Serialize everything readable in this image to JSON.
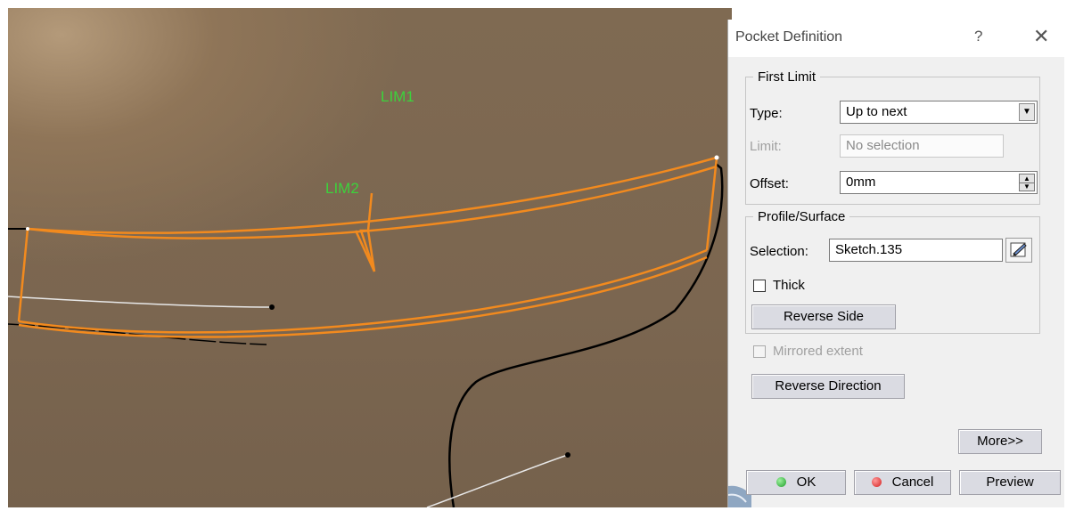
{
  "viewport": {
    "label_lim1": "LIM1",
    "label_lim2": "LIM2",
    "profile_color": "#f28a1e",
    "background_color": "#7d6850"
  },
  "dialog": {
    "title": "Pocket Definition",
    "help_label": "?",
    "close_label": "✕",
    "first_limit": {
      "legend": "First Limit",
      "type_label": "Type:",
      "type_value": "Up to next",
      "limit_label": "Limit:",
      "limit_value": "No selection",
      "offset_label": "Offset:",
      "offset_value": "0mm"
    },
    "profile_surface": {
      "legend": "Profile/Surface",
      "selection_label": "Selection:",
      "selection_value": "Sketch.135",
      "thick_label": "Thick",
      "thick_checked": false,
      "reverse_side_label": "Reverse Side"
    },
    "mirrored_extent_label": "Mirrored extent",
    "mirrored_extent_checked": false,
    "reverse_direction_label": "Reverse Direction",
    "more_label": "More>>",
    "ok_label": "OK",
    "cancel_label": "Cancel",
    "preview_label": "Preview",
    "ok_color": "#1e9e2a",
    "cancel_color": "#d42020"
  }
}
